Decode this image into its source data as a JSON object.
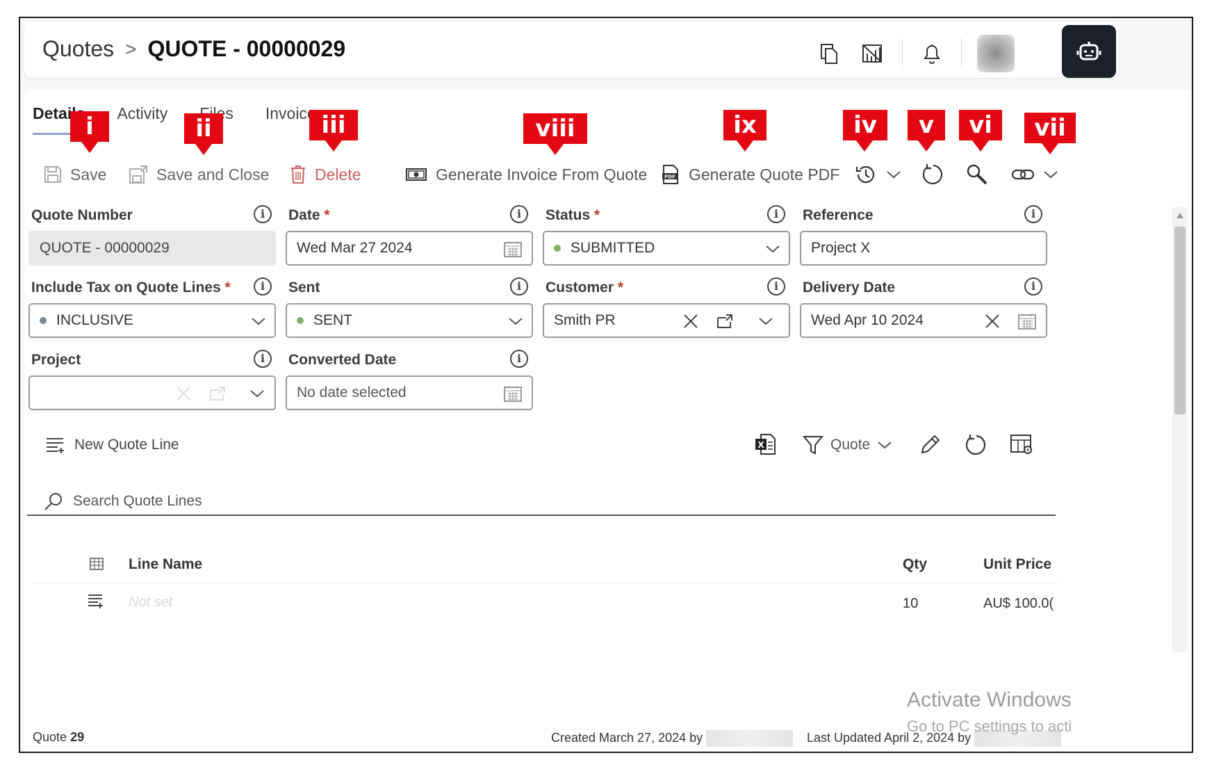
{
  "header": {
    "breadcrumb_root": "Quotes",
    "breadcrumb_sep": ">",
    "title": "QUOTE - 00000029"
  },
  "tabs": [
    {
      "label": "Details",
      "active": true
    },
    {
      "label": "Activity",
      "active": false
    },
    {
      "label": "Files",
      "active": false
    },
    {
      "label": "Invoices",
      "active": false
    }
  ],
  "toolbar": {
    "save": "Save",
    "save_close": "Save and Close",
    "delete": "Delete",
    "generate_invoice": "Generate Invoice From Quote",
    "generate_pdf": "Generate Quote PDF"
  },
  "annotations": [
    "i",
    "ii",
    "iii",
    "viii",
    "ix",
    "iv",
    "v",
    "vi",
    "vii"
  ],
  "form": {
    "quote_number": {
      "label": "Quote Number",
      "value": "QUOTE - 00000029"
    },
    "date": {
      "label": "Date",
      "required": "*",
      "value": "Wed Mar 27 2024"
    },
    "status": {
      "label": "Status",
      "required": "*",
      "value": "SUBMITTED",
      "dot_color": "#7fb069"
    },
    "reference": {
      "label": "Reference",
      "value": "Project X"
    },
    "include_tax": {
      "label": "Include Tax on Quote Lines",
      "required": "*",
      "value": "INCLUSIVE",
      "dot_color": "#7a8699"
    },
    "sent": {
      "label": "Sent",
      "value": "SENT",
      "dot_color": "#7fb069"
    },
    "customer": {
      "label": "Customer",
      "required": "*",
      "value": "Smith PR"
    },
    "delivery_date": {
      "label": "Delivery Date",
      "value": "Wed Apr 10 2024"
    },
    "project": {
      "label": "Project",
      "value": ""
    },
    "converted_date": {
      "label": "Converted Date",
      "placeholder": "No date selected"
    }
  },
  "lines": {
    "new_line": "New Quote Line",
    "filter_label": "Quote",
    "search_placeholder": "Search Quote Lines",
    "columns": {
      "name": "Line Name",
      "qty": "Qty",
      "unit_price": "Unit Price"
    },
    "rows": [
      {
        "name": "Not set",
        "qty": "10",
        "unit_price": "AU$ 100.0("
      }
    ]
  },
  "footer": {
    "record_label": "Quote",
    "record_number": "29",
    "created": "Created March 27, 2024 by",
    "updated": "Last Updated April 2, 2024 by"
  },
  "watermark": {
    "line1": "Activate Windows",
    "line2": "Go to PC settings to acti"
  },
  "colors": {
    "annotation": "#e30613",
    "bot_button": "#1c2029",
    "delete": "#c96060"
  }
}
